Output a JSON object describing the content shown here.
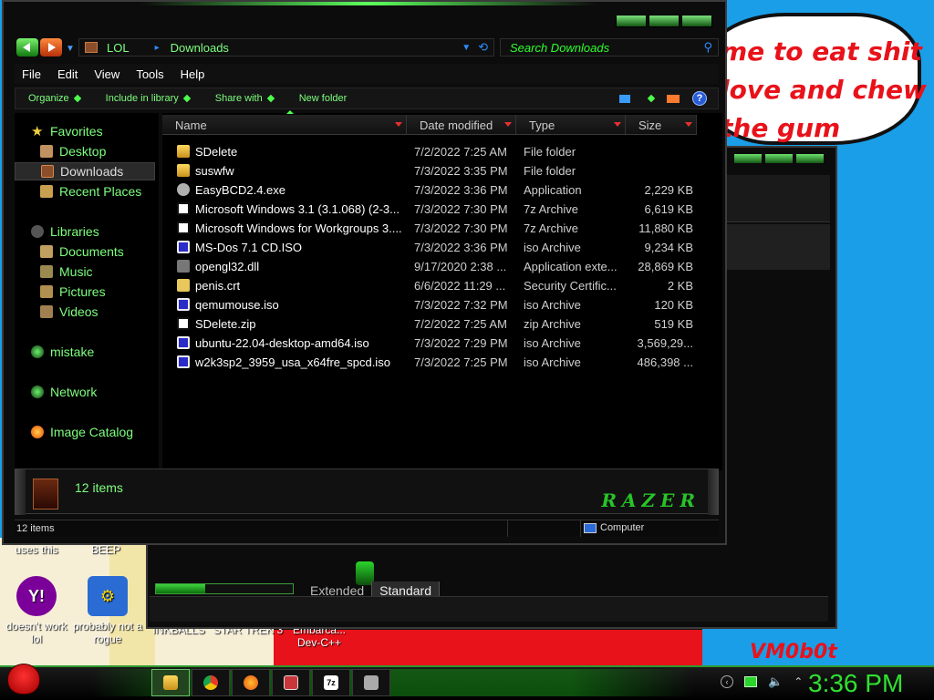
{
  "desktop": {
    "bubble_text": "me to eat shit\nlove and chew\nthe gum",
    "watermark": "VM0b0t",
    "icons": [
      {
        "label": "uses this"
      },
      {
        "label": "BEEP"
      },
      {
        "label": "doesn't work lol"
      },
      {
        "label": "probably not a rogue"
      },
      {
        "label": "INKBALLS"
      },
      {
        "label": "STAR TREK 3"
      },
      {
        "label": "Embarca... Dev-C++"
      }
    ]
  },
  "media_player": {
    "tabs": [
      "Extended",
      "Standard"
    ],
    "slider_level": 0.36
  },
  "explorer": {
    "breadcrumbs": [
      "LOL",
      "Downloads"
    ],
    "search_placeholder": "Search Downloads",
    "menu": [
      "File",
      "Edit",
      "View",
      "Tools",
      "Help"
    ],
    "toolbar": {
      "organize": "Organize",
      "include": "Include in library",
      "share": "Share with",
      "new_folder": "New folder",
      "help": "?"
    },
    "nav": {
      "favorites": "Favorites",
      "desktop": "Desktop",
      "downloads": "Downloads",
      "recent": "Recent Places",
      "libraries": "Libraries",
      "documents": "Documents",
      "music": "Music",
      "pictures": "Pictures",
      "videos": "Videos",
      "mistake": "mistake",
      "network": "Network",
      "image_catalog": "Image Catalog"
    },
    "columns": {
      "name": "Name",
      "date": "Date modified",
      "type": "Type",
      "size": "Size"
    },
    "files": [
      {
        "name": "SDelete",
        "date": "7/2/2022 7:25 AM",
        "type": "File folder",
        "size": "",
        "icon": "folder"
      },
      {
        "name": "suswfw",
        "date": "7/3/2022 3:35 PM",
        "type": "File folder",
        "size": "",
        "icon": "folder"
      },
      {
        "name": "EasyBCD2.4.exe",
        "date": "7/3/2022 3:36 PM",
        "type": "Application",
        "size": "2,229 KB",
        "icon": "app"
      },
      {
        "name": "Microsoft Windows 3.1 (3.1.068) (2-3...",
        "date": "7/3/2022 7:30 PM",
        "type": "7z Archive",
        "size": "6,619 KB",
        "icon": "7z"
      },
      {
        "name": "Microsoft Windows for Workgroups 3....",
        "date": "7/3/2022 7:30 PM",
        "type": "7z Archive",
        "size": "11,880 KB",
        "icon": "7z"
      },
      {
        "name": "MS-Dos 7.1 CD.ISO",
        "date": "7/3/2022 3:36 PM",
        "type": "iso Archive",
        "size": "9,234 KB",
        "icon": "iso"
      },
      {
        "name": "opengl32.dll",
        "date": "9/17/2020 2:38 ...",
        "type": "Application exte...",
        "size": "28,869 KB",
        "icon": "dll"
      },
      {
        "name": "penis.crt",
        "date": "6/6/2022 11:29 ...",
        "type": "Security Certific...",
        "size": "2 KB",
        "icon": "crt"
      },
      {
        "name": "qemumouse.iso",
        "date": "7/3/2022 7:32 PM",
        "type": "iso Archive",
        "size": "120 KB",
        "icon": "iso"
      },
      {
        "name": "SDelete.zip",
        "date": "7/2/2022 7:25 AM",
        "type": "zip Archive",
        "size": "519 KB",
        "icon": "7z"
      },
      {
        "name": "ubuntu-22.04-desktop-amd64.iso",
        "date": "7/3/2022 7:29 PM",
        "type": "iso Archive",
        "size": "3,569,29...",
        "icon": "iso"
      },
      {
        "name": "w2k3sp2_3959_usa_x64fre_spcd.iso",
        "date": "7/3/2022 7:25 PM",
        "type": "iso Archive",
        "size": "486,398 ...",
        "icon": "iso"
      }
    ],
    "details_count": "12 items",
    "brand": "RAZER",
    "status_left": "12 items",
    "status_right": "Computer"
  },
  "taskbar": {
    "clock": "3:36 PM",
    "tasks": [
      "explorer",
      "chrome",
      "firefox",
      "app",
      "7zip",
      "tool"
    ],
    "seven_zip_label": "7z"
  },
  "colors": {
    "accent_green": "#7dff7d",
    "clock_green": "#2fe02f",
    "desktop_blue": "#1a9ee8",
    "meme_red": "#e8121a"
  }
}
